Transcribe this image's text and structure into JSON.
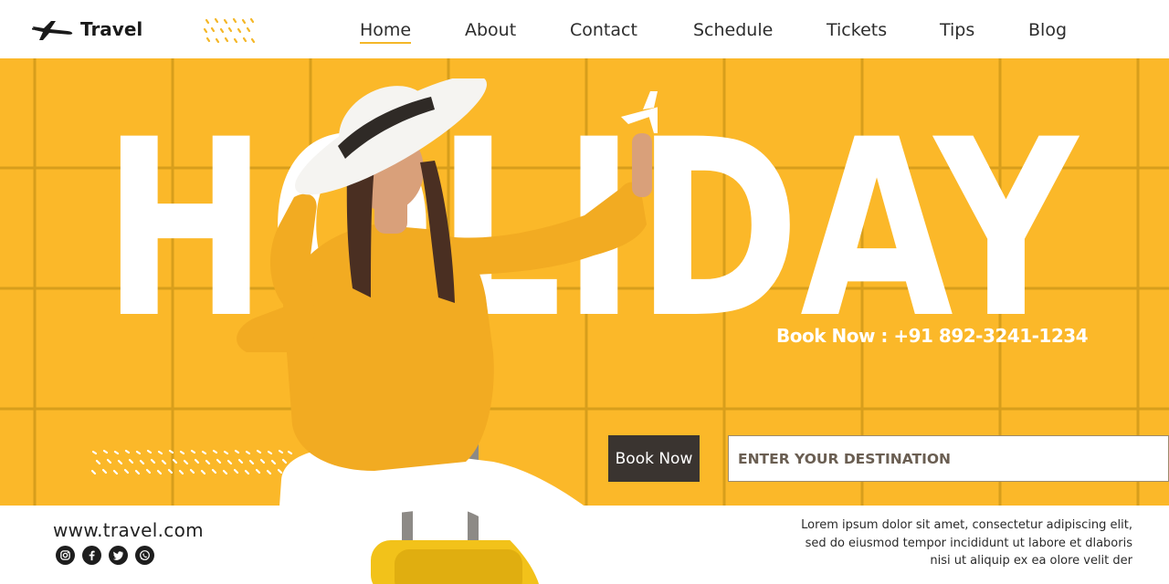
{
  "brand": {
    "name": "Travel",
    "logo_icon": "airplane-icon"
  },
  "nav": {
    "items": [
      {
        "label": "Home",
        "active": true
      },
      {
        "label": "About",
        "active": false
      },
      {
        "label": "Contact",
        "active": false
      },
      {
        "label": "Schedule",
        "active": false
      },
      {
        "label": "Tickets",
        "active": false
      },
      {
        "label": "Tips",
        "active": false
      },
      {
        "label": "Blog",
        "active": false
      }
    ]
  },
  "hero": {
    "headline": "HOLIDAY",
    "phone_text": "Book Now : +91 892-3241-1234",
    "book_button": "Book Now",
    "destination_placeholder": "ENTER YOUR DESTINATION"
  },
  "footer": {
    "url": "www.travel.com",
    "socials": [
      "instagram-icon",
      "facebook-icon",
      "twitter-icon",
      "whatsapp-icon"
    ],
    "description_lines": [
      "Lorem ipsum dolor sit amet, consectetur adipiscing elit,",
      "sed do eiusmod tempor incididunt ut labore et dlaboris",
      "nisi ut aliquip ex ea olore velit der"
    ]
  },
  "colors": {
    "accent": "#fbb829",
    "grid_line": "#d79e1c",
    "dark_button": "#3a3430",
    "headline": "#ffffff"
  }
}
